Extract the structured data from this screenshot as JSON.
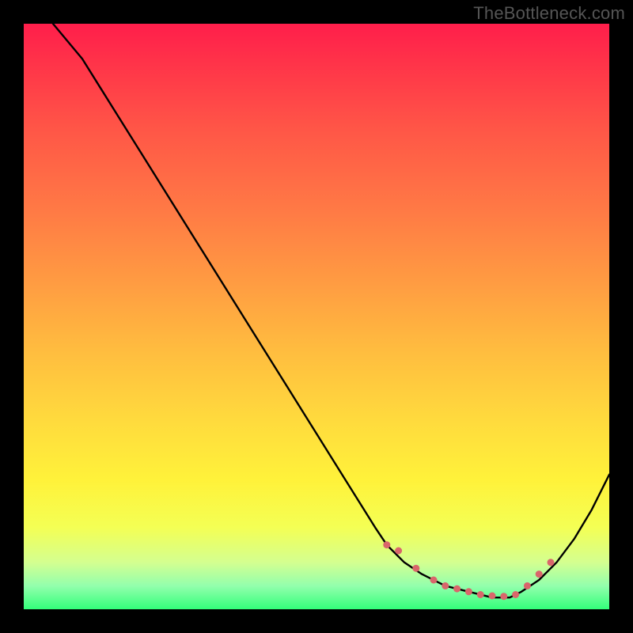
{
  "attribution": "TheBottleneck.com",
  "chart_data": {
    "type": "line",
    "title": "",
    "xlabel": "",
    "ylabel": "",
    "xlim": [
      0,
      100
    ],
    "ylim": [
      0,
      100
    ],
    "grid": false,
    "legend": false,
    "series": [
      {
        "name": "bottleneck-curve",
        "color": "#000000",
        "x": [
          5,
          10,
          15,
          20,
          25,
          30,
          35,
          40,
          45,
          50,
          55,
          60,
          62,
          65,
          68,
          72,
          76,
          80,
          83,
          85,
          88,
          91,
          94,
          97,
          100
        ],
        "y": [
          100,
          94,
          86,
          78,
          70,
          62,
          54,
          46,
          38,
          30,
          22,
          14,
          11,
          8,
          6,
          4,
          3,
          2,
          2,
          3,
          5,
          8,
          12,
          17,
          23
        ]
      }
    ],
    "markers": [
      {
        "name": "highlight-dots",
        "color": "#d9666b",
        "points": [
          {
            "x": 62,
            "y": 11
          },
          {
            "x": 64,
            "y": 10
          },
          {
            "x": 67,
            "y": 7
          },
          {
            "x": 70,
            "y": 5
          },
          {
            "x": 72,
            "y": 4
          },
          {
            "x": 74,
            "y": 3.5
          },
          {
            "x": 76,
            "y": 3
          },
          {
            "x": 78,
            "y": 2.5
          },
          {
            "x": 80,
            "y": 2.3
          },
          {
            "x": 82,
            "y": 2.2
          },
          {
            "x": 84,
            "y": 2.5
          },
          {
            "x": 86,
            "y": 4
          },
          {
            "x": 88,
            "y": 6
          },
          {
            "x": 90,
            "y": 8
          }
        ]
      }
    ]
  },
  "colors": {
    "background": "#000000",
    "curve": "#000000",
    "marker": "#d9666b"
  }
}
